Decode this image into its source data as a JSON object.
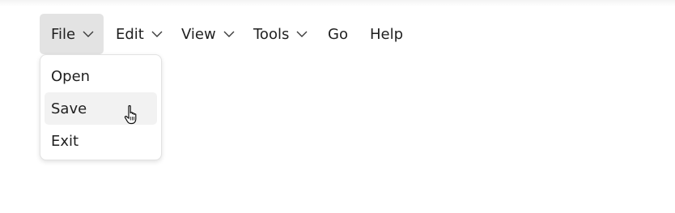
{
  "menubar": {
    "items": [
      {
        "label": "File",
        "has_chevron": true,
        "state": "open"
      },
      {
        "label": "Edit",
        "has_chevron": true
      },
      {
        "label": "View",
        "has_chevron": true
      },
      {
        "label": "Tools",
        "has_chevron": true
      },
      {
        "label": "Go",
        "has_chevron": false
      },
      {
        "label": "Help",
        "has_chevron": false
      }
    ]
  },
  "file_menu": {
    "items": [
      {
        "label": "Open"
      },
      {
        "label": "Save",
        "state": "hovered"
      },
      {
        "label": "Exit"
      }
    ]
  },
  "icons": {
    "chevron": "chevron-down-icon",
    "cursor": "hand-pointer-icon"
  },
  "colors": {
    "active_menu_bg": "#e3e3e3",
    "hover_item_bg": "#f2f2f2",
    "text": "#1f1f1f"
  }
}
